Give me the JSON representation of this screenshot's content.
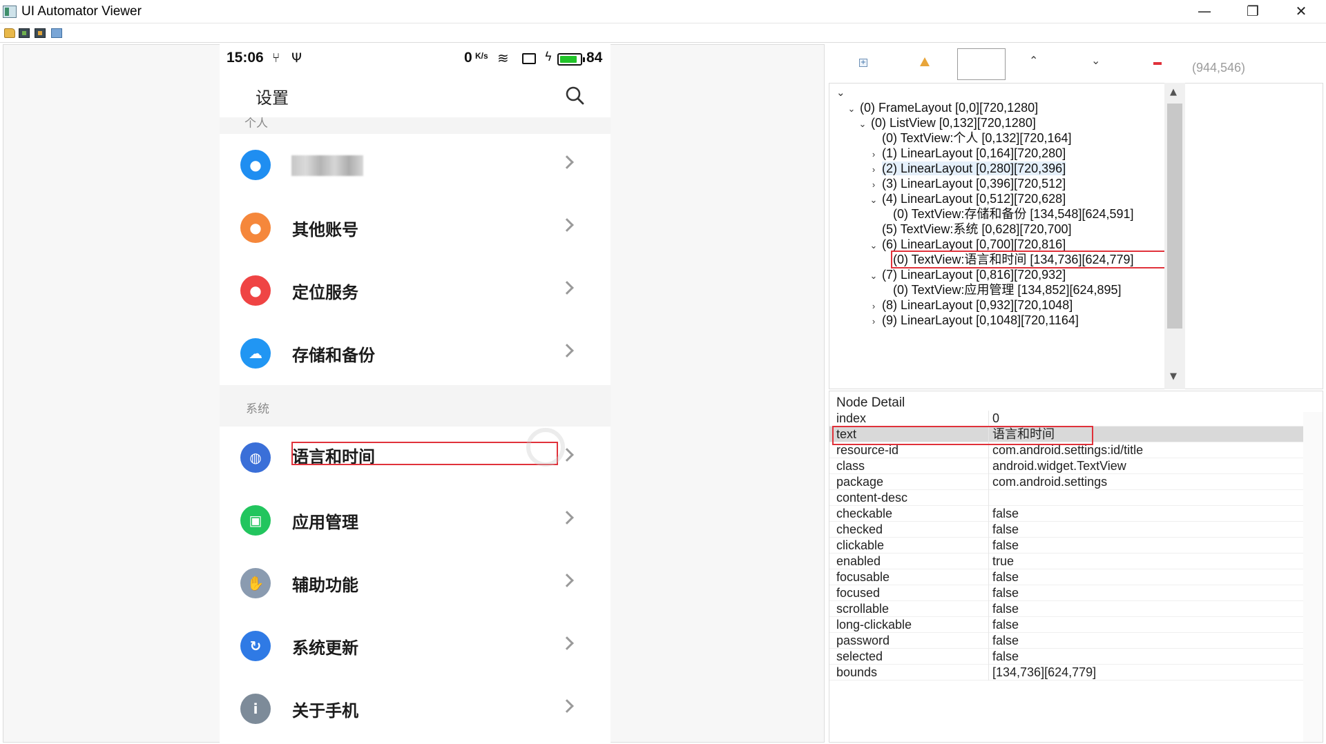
{
  "window": {
    "title": "UI Automator Viewer",
    "minimize": "—",
    "maximize": "❐",
    "close": "✕"
  },
  "phone": {
    "status": {
      "time": "15:06",
      "speed": "0",
      "speed_unit": "K/s",
      "battery": "84",
      "battery_fraction": 0.84
    },
    "title": "设置",
    "cutoff_section": "个人",
    "personal_rows": [
      {
        "label": "",
        "icon": "account-icon",
        "color": "#1f8ef1",
        "glyph": "●"
      },
      {
        "label": "其他账号",
        "icon": "person-icon",
        "color": "#f5873b",
        "glyph": "●"
      },
      {
        "label": "定位服务",
        "icon": "location-pin-icon",
        "color": "#ef4444",
        "glyph": "●"
      },
      {
        "label": "存储和备份",
        "icon": "cloud-icon",
        "color": "#2196f3",
        "glyph": "☁"
      }
    ],
    "system_section": "系统",
    "system_rows": [
      {
        "label": "语言和时间",
        "icon": "globe-icon",
        "color": "#3a6fd8",
        "glyph": "◍"
      },
      {
        "label": "应用管理",
        "icon": "android-icon",
        "color": "#22c55e",
        "glyph": "▣"
      },
      {
        "label": "辅助功能",
        "icon": "hand-icon",
        "color": "#8a9bb0",
        "glyph": "✋"
      },
      {
        "label": "系统更新",
        "icon": "update-icon",
        "color": "#2f7ae5",
        "glyph": "↻"
      },
      {
        "label": "关于手机",
        "icon": "info-icon",
        "color": "#7d8b99",
        "glyph": "i"
      }
    ]
  },
  "inspector": {
    "coords": "(944,546)",
    "tree": [
      {
        "indent": 0,
        "twisty": "⌄",
        "label": "(0) FrameLayout [0,0][720,1280]"
      },
      {
        "indent": 1,
        "twisty": "⌄",
        "label": "(0) ListView [0,132][720,1280]"
      },
      {
        "indent": 2,
        "twisty": "",
        "label": "(0) TextView:个人 [0,132][720,164]"
      },
      {
        "indent": 2,
        "twisty": "›",
        "label": "(1) LinearLayout [0,164][720,280]"
      },
      {
        "indent": 2,
        "twisty": "›",
        "label": "(2) LinearLayout [0,280][720,396]",
        "highlight": true
      },
      {
        "indent": 2,
        "twisty": "›",
        "label": "(3) LinearLayout [0,396][720,512]"
      },
      {
        "indent": 2,
        "twisty": "⌄",
        "label": "(4) LinearLayout [0,512][720,628]"
      },
      {
        "indent": 3,
        "twisty": "",
        "label": "(0) TextView:存储和备份 [134,548][624,591]"
      },
      {
        "indent": 2,
        "twisty": "",
        "label": "(5) TextView:系统 [0,628][720,700]"
      },
      {
        "indent": 2,
        "twisty": "⌄",
        "label": "(6) LinearLayout [0,700][720,816]"
      },
      {
        "indent": 3,
        "twisty": "",
        "label": "(0) TextView:语言和时间 [134,736][624,779]",
        "selected": true
      },
      {
        "indent": 2,
        "twisty": "⌄",
        "label": "(7) LinearLayout [0,816][720,932]"
      },
      {
        "indent": 3,
        "twisty": "",
        "label": "(0) TextView:应用管理 [134,852][624,895]"
      },
      {
        "indent": 2,
        "twisty": "›",
        "label": "(8) LinearLayout [0,932][720,1048]"
      },
      {
        "indent": 2,
        "twisty": "›",
        "label": "(9) LinearLayout [0,1048][720,1164]"
      }
    ],
    "detail_title": "Node Detail",
    "details": [
      {
        "key": "index",
        "value": "0"
      },
      {
        "key": "text",
        "value": "语言和时间",
        "selected": true
      },
      {
        "key": "resource-id",
        "value": "com.android.settings:id/title"
      },
      {
        "key": "class",
        "value": "android.widget.TextView"
      },
      {
        "key": "package",
        "value": "com.android.settings"
      },
      {
        "key": "content-desc",
        "value": ""
      },
      {
        "key": "checkable",
        "value": "false"
      },
      {
        "key": "checked",
        "value": "false"
      },
      {
        "key": "clickable",
        "value": "false"
      },
      {
        "key": "enabled",
        "value": "true"
      },
      {
        "key": "focusable",
        "value": "false"
      },
      {
        "key": "focused",
        "value": "false"
      },
      {
        "key": "scrollable",
        "value": "false"
      },
      {
        "key": "long-clickable",
        "value": "false"
      },
      {
        "key": "password",
        "value": "false"
      },
      {
        "key": "selected",
        "value": "false"
      },
      {
        "key": "bounds",
        "value": "[134,736][624,779]"
      }
    ]
  }
}
